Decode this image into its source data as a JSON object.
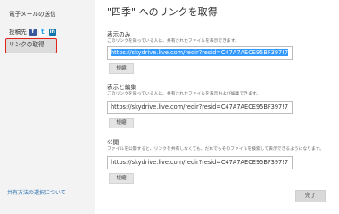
{
  "sidebar": {
    "email": "電子メールの送信",
    "post": "投稿先",
    "social": {
      "facebook": "f",
      "twitter": "t",
      "linkedin": "in"
    },
    "get_link": "リンクの取得",
    "help": "共有方法の選択について"
  },
  "main": {
    "title": "\"四季\" へのリンクを取得",
    "sections": [
      {
        "title": "表示のみ",
        "desc": "このリンクを知っている人は、共有されたファイルを表示できます。",
        "url": "https://skydrive.live.com/redir?resid=C47A7AECE95BF397!7",
        "shorten": "短縮"
      },
      {
        "title": "表示と編集",
        "desc": "このリンクを知っている人は、共有されたファイルを表示および編集できます。",
        "url": "https://skydrive.live.com/redir?resid=C47A7AECE95BF397!7",
        "shorten": "短縮"
      },
      {
        "title": "公開",
        "desc": "ファイルを公開すると、リンクを共有しなくても、だれでもそのファイルを検索して表示できるようになります。",
        "url": "https://skydrive.live.com/redir?resid=C47A7AECE95BF397!7",
        "shorten": "短縮"
      }
    ],
    "done": "完了"
  },
  "colors": {
    "highlight": "#e0241c",
    "selection": "#3399ff",
    "link": "#2a6fb0"
  }
}
